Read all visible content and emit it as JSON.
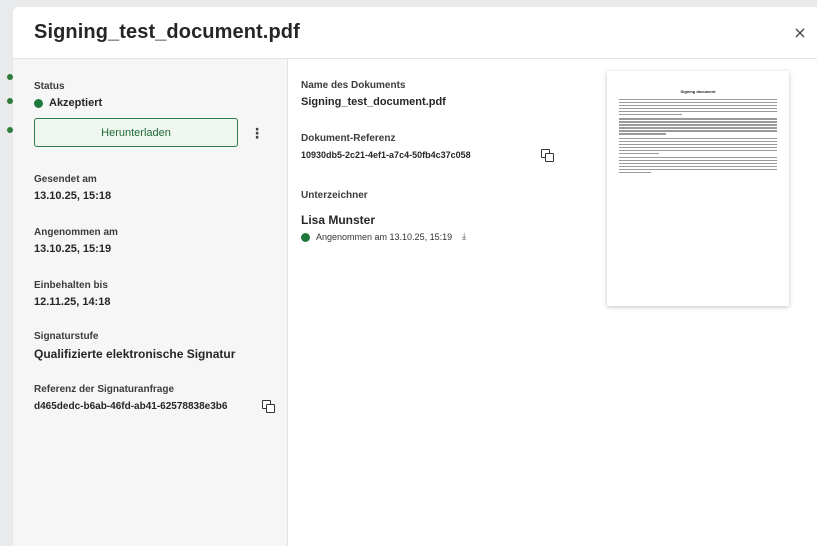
{
  "modal": {
    "title": "Signing_test_document.pdf",
    "close_label": "×"
  },
  "status": {
    "label": "Status",
    "value": "Akzeptiert",
    "color": "#1e7a3c"
  },
  "actions": {
    "download_label": "Herunterladen",
    "more_label": "⋮"
  },
  "sent": {
    "label": "Gesendet am",
    "value": "13.10.25, 15:18"
  },
  "accepted": {
    "label": "Angenommen am",
    "value": "13.10.25, 15:19"
  },
  "retained": {
    "label": "Einbehalten bis",
    "value": "12.11.25, 14:18"
  },
  "signature_level": {
    "label": "Signaturstufe",
    "value": "Qualifizierte elektronische Signatur"
  },
  "request_ref": {
    "label": "Referenz der Signaturanfrage",
    "value": "d465dedc-b6ab-46fd-ab41-62578838e3b6"
  },
  "document": {
    "name_label": "Name des Dokuments",
    "name_value": "Signing_test_document.pdf",
    "ref_label": "Dokument-Referenz",
    "ref_value": "10930db5-2c21-4ef1-a7c4-50fb4c37c058"
  },
  "signers": {
    "label": "Unterzeichner",
    "items": [
      {
        "name": "Lisa Munster",
        "status": "Angenommen am 13.10.25, 15:19"
      }
    ]
  },
  "preview": {
    "title": "Signing document"
  },
  "icons": {
    "copy": "copy-icon",
    "download": "download-icon",
    "close": "close-icon",
    "more": "more-vertical-icon"
  }
}
